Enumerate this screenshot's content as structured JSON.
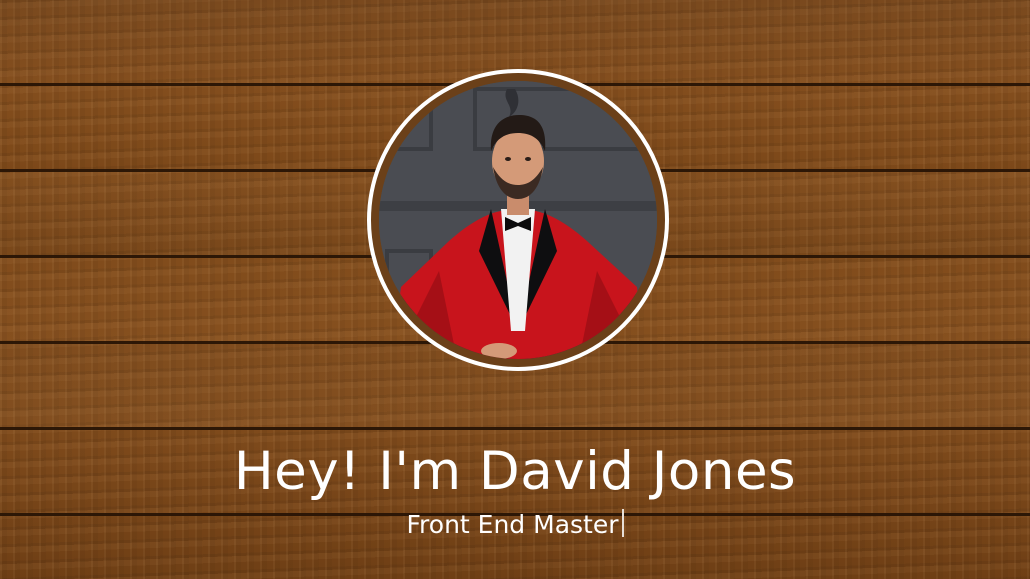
{
  "hero": {
    "title": "Hey! I'm David Jones",
    "subtitle": "Front End Master",
    "avatar_alt": "Portrait of man in red velvet tuxedo jacket"
  },
  "colors": {
    "wood": "#7c4819",
    "text": "#ffffff",
    "ring": "#ffffff",
    "jacket": "#c8141c"
  }
}
